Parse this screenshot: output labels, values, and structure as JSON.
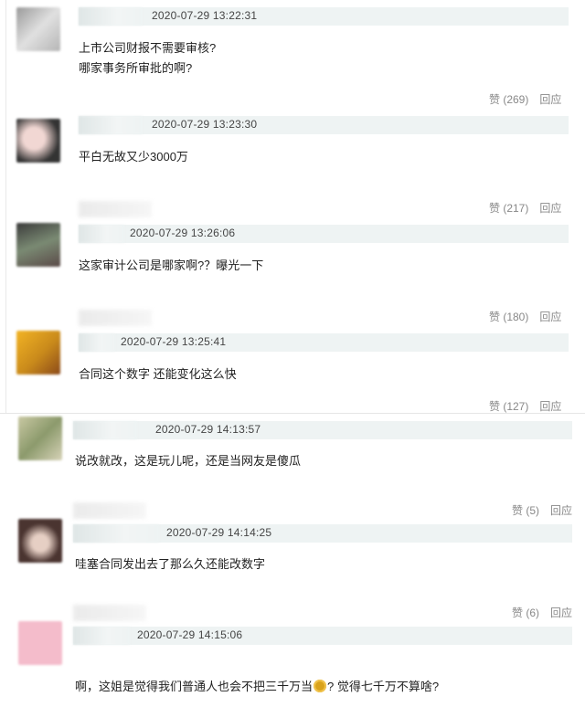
{
  "comments": [
    {
      "timestamp": "2020-07-29 13:22:31",
      "text": "上市公司财报不需要审核?\n哪家事务所审批的啊?",
      "likes": "赞 (269)",
      "reply": "回应",
      "avatar_color": "#bfbfbf"
    },
    {
      "timestamp": "2020-07-29 13:23:30",
      "text": "平白无故又少3000万",
      "likes": "赞 (217)",
      "reply": "回应",
      "avatar_color": "#d9c2c0"
    },
    {
      "timestamp": "2020-07-29 13:26:06",
      "text": "这家审计公司是哪家啊?？曝光一下",
      "likes": "赞 (180)",
      "reply": "回应",
      "avatar_color": "#5d6a5a"
    },
    {
      "timestamp": "2020-07-29 13:25:41",
      "text": "合同这个数字 还能变化这么快",
      "likes": "赞 (127)",
      "reply": "回应",
      "avatar_color": "#e2a72a"
    },
    {
      "timestamp": "2020-07-29 14:13:57",
      "text": "说改就改，这是玩儿呢，还是当网友是傻瓜",
      "likes": "赞 (5)",
      "reply": "回应",
      "avatar_color": "#a9ae8f"
    },
    {
      "timestamp": "2020-07-29 14:14:25",
      "text": "哇塞合同发出去了那么久还能改数字",
      "likes": "赞 (6)",
      "reply": "回应",
      "avatar_color": "#7a6560"
    },
    {
      "timestamp": "2020-07-29 14:15:06",
      "text_before": "啊，这姐是觉得我们普通人也会不把三千万当",
      "text_after": "? 觉得七千万不算啥?",
      "avatar_color": "#f2b9c9"
    }
  ]
}
